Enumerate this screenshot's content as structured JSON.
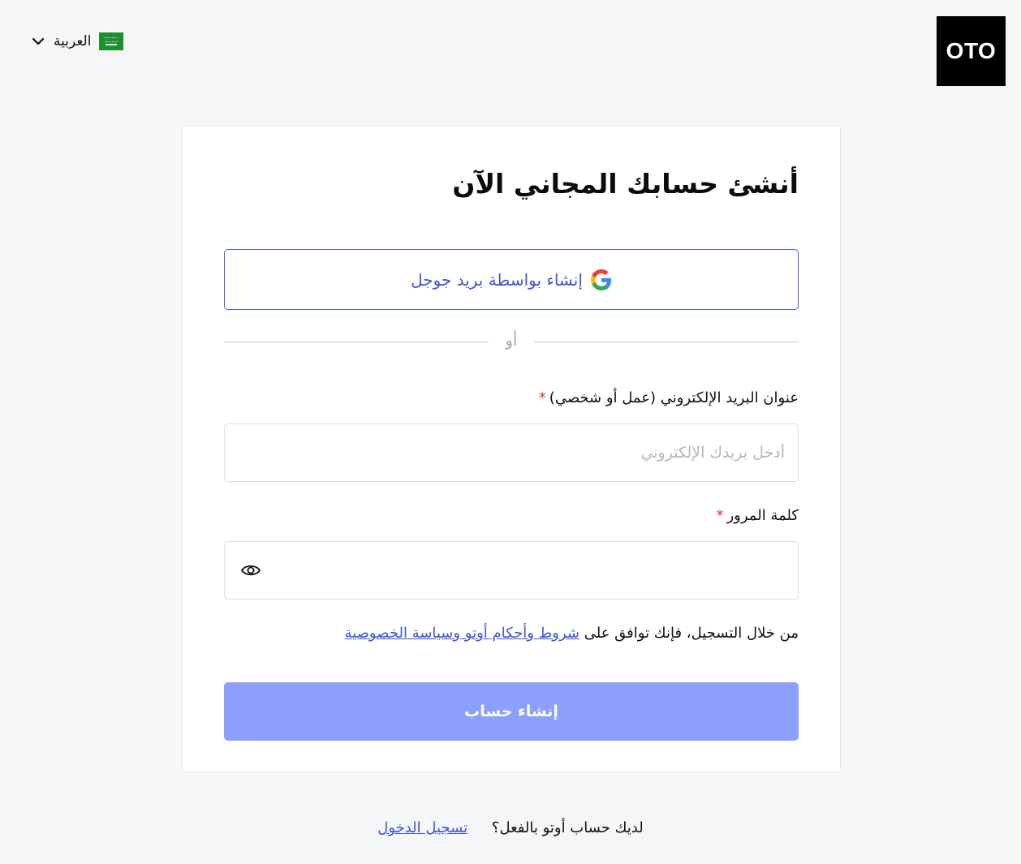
{
  "header": {
    "language_label": "العربية",
    "flag_icon": "saudi-flag-icon",
    "chevron_icon": "chevron-down-icon",
    "logo_text": "OTO"
  },
  "form": {
    "title": "أنشئ حسابك المجاني الآن",
    "google_button_label": "إنشاء بواسطة بريد جوجل",
    "google_icon": "google-icon",
    "divider_text": "أو",
    "email_label": "عنوان البريد الإلكتروني (عمل أو شخصي)",
    "email_placeholder": "أدخل بريدك الإلكتروني",
    "email_value": "",
    "password_label": "كلمة المرور",
    "password_value": "",
    "required_marker": "*",
    "eye_icon": "eye-icon",
    "terms_prefix": "من خلال التسجيل، فإنك توافق على",
    "terms_link": "شروط وأحكام أوتو وسياسة الخصوصية",
    "submit_label": "إنشاء حساب"
  },
  "footer": {
    "prompt": "لديك حساب أوتو بالفعل؟",
    "login_link": "تسجيل الدخول"
  },
  "colors": {
    "accent": "#3d55dc",
    "submit_bg": "#8c9ffd",
    "required": "#e0352b",
    "logo_bg": "#000000",
    "page_bg": "#f5f6f8"
  }
}
